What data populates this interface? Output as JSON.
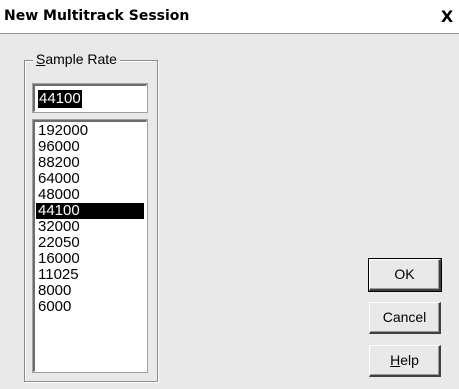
{
  "window": {
    "title": "New Multitrack Session",
    "close_label": "X"
  },
  "sample_rate": {
    "group_label_accel": "S",
    "group_label_rest": "ample Rate",
    "input_value": "44100",
    "options": [
      "192000",
      "96000",
      "88200",
      "64000",
      "48000",
      "44100",
      "32000",
      "22050",
      "16000",
      "11025",
      "8000",
      "6000"
    ],
    "selected": "44100"
  },
  "buttons": {
    "ok_label": "OK",
    "cancel_label": "Cancel",
    "help_accel": "H",
    "help_rest": "elp"
  }
}
